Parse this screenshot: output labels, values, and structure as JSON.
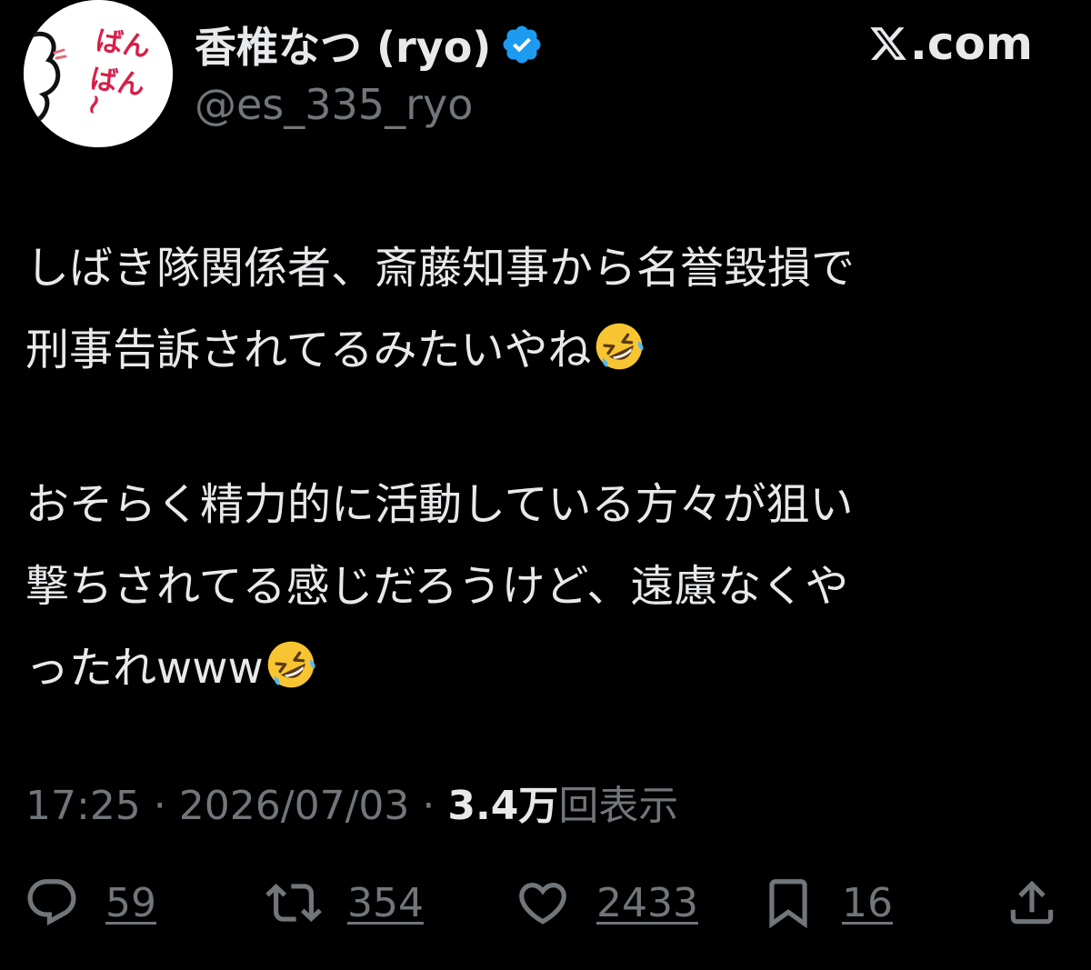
{
  "author": {
    "display_name": "香椎なつ (ryo)",
    "handle": "@es_335_ryo",
    "avatar_text": "ばんばん~",
    "verified_color": "#1d9bf0"
  },
  "brand": {
    "site": ".com"
  },
  "tweet": {
    "lines": [
      "しばき隊関係者、斎藤知事から名誉毀損で",
      "刑事告訴されてるみたいやね",
      "おそらく精力的に活動している方々が狙い",
      "撃ちされてる感じだろうけど、遠慮なくや",
      "ったれwww"
    ],
    "emoji": "rolling-on-the-floor-laughing"
  },
  "meta": {
    "time": "17:25",
    "separator": " · ",
    "date": "2026/07/03",
    "views_count": "3.4万",
    "views_label": "回表示"
  },
  "actions": {
    "replies": "59",
    "retweets": "354",
    "likes": "2433",
    "bookmarks": "16"
  },
  "colors": {
    "background": "#000000",
    "text_primary": "#e7e9ea",
    "text_secondary": "#71767b",
    "accent": "#1d9bf0"
  }
}
